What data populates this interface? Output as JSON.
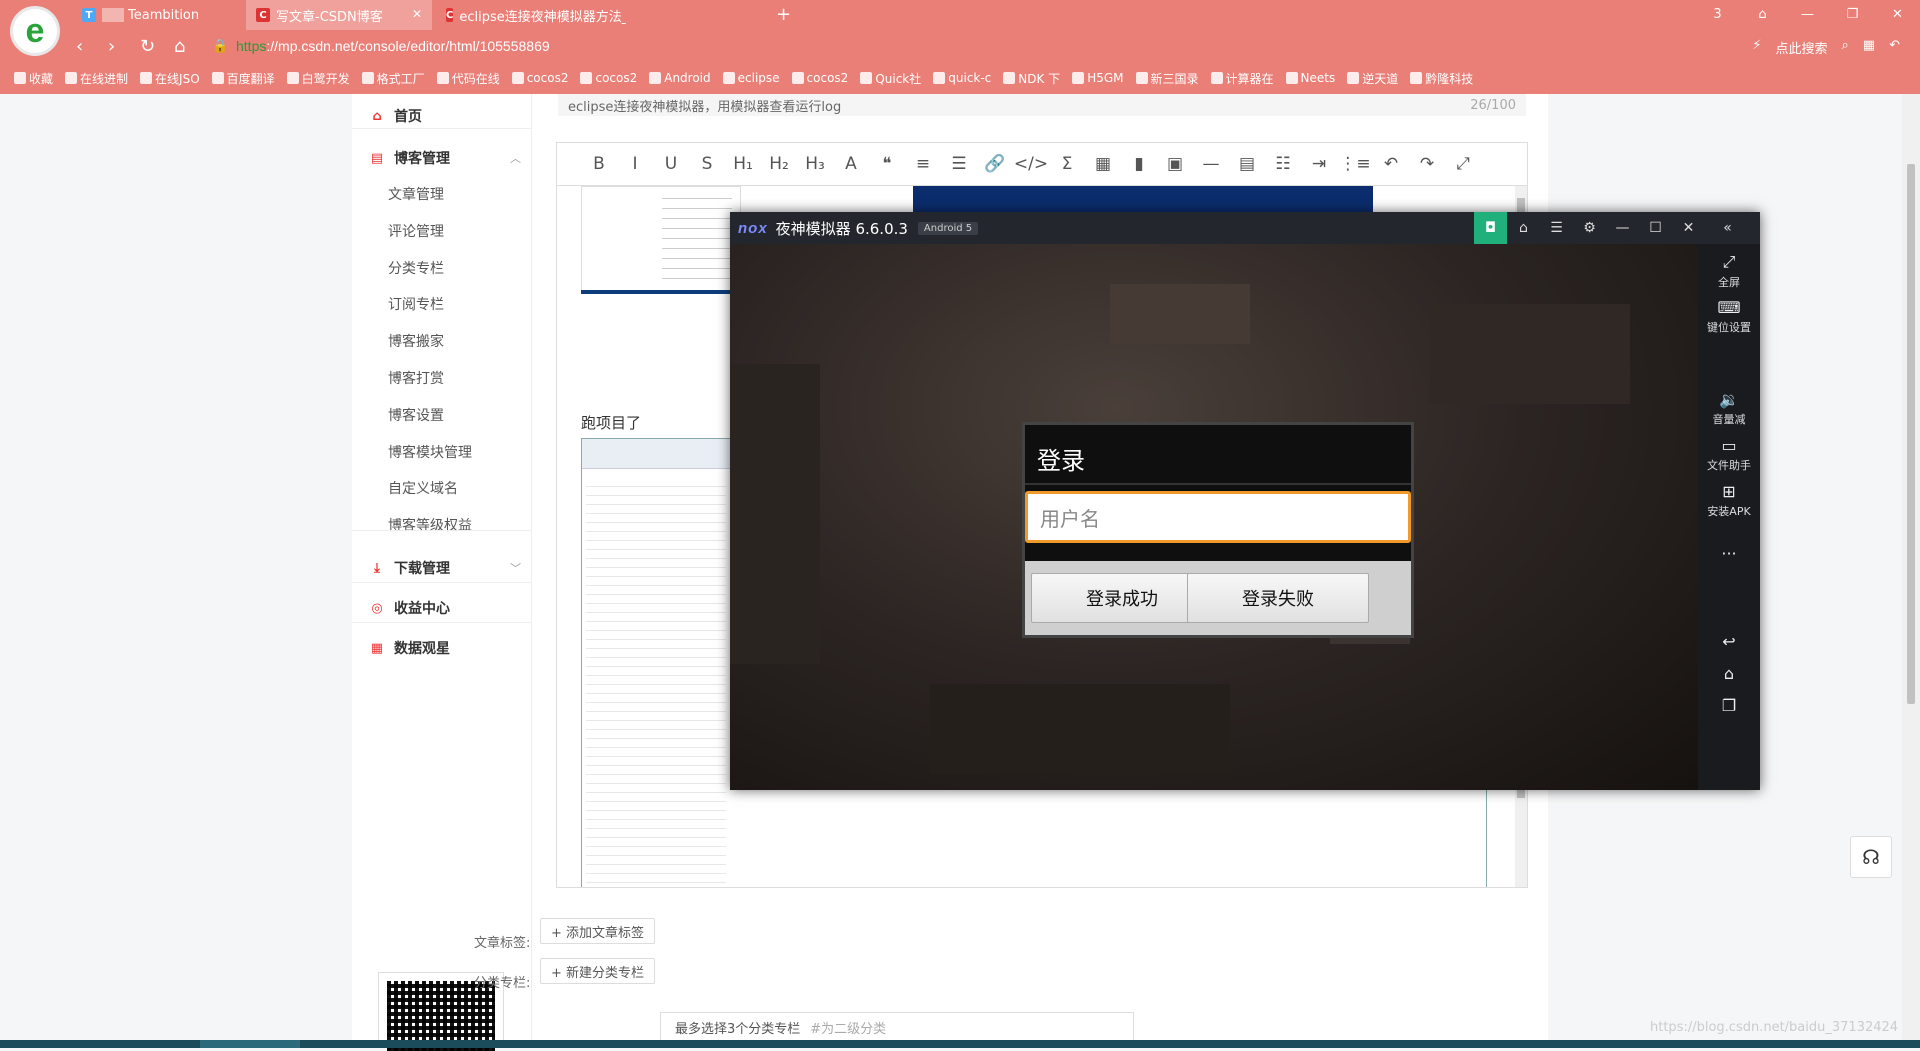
{
  "browser": {
    "tabs": [
      {
        "label": "Teambition",
        "favicon_color": "#4fa8f5",
        "favicon_text": "T"
      },
      {
        "label": "写文章-CSDN博客",
        "favicon_color": "#d33",
        "favicon_text": "C",
        "active": true
      },
      {
        "label": "eclipse连接夜神模拟器方法_开发",
        "favicon_color": "#d33",
        "favicon_text": "C"
      }
    ],
    "tab_count": "3",
    "url": "https://mp.csdn.net/console/editor/html/105558869",
    "url_scheme": "https",
    "url_rest": "://mp.csdn.net/console/editor/html/105558869",
    "search_label": "点此搜索",
    "bookmarks": [
      "收藏",
      "在线进制",
      "在线JSO",
      "百度翻译",
      "白鹭开发",
      "格式工厂",
      "代码在线",
      "cocos2",
      "cocos2",
      "Android",
      "eclipse",
      "cocos2",
      "Quick社",
      "quick-c",
      "NDK 下",
      "H5GM",
      "新三国录",
      "计算器在",
      "Neets",
      "逆天道",
      "黔隆科技"
    ]
  },
  "sidebar": {
    "home": "首页",
    "blog_manage": "博客管理",
    "blog_items": [
      "文章管理",
      "评论管理",
      "分类专栏",
      "订阅专栏",
      "博客搬家",
      "博客打赏",
      "博客设置",
      "博客模块管理",
      "自定义域名",
      "博客等级权益"
    ],
    "download_manage": "下载管理",
    "income_center": "收益中心",
    "data_view": "数据观星"
  },
  "editor": {
    "title_value": "eclipse连接夜神模拟器，用模拟器查看运行log",
    "title_count": "26/100",
    "toolbar": [
      "B",
      "I",
      "U",
      "S",
      "H₁",
      "H₂",
      "H₃",
      "A",
      "❝",
      "≡",
      "☰",
      "🔗",
      "</>",
      "Σ",
      "▦",
      "▮",
      "▣",
      "—",
      "▤",
      "☷",
      "⇥",
      "⋮≡",
      "↶",
      "↷",
      "⤢"
    ],
    "paragraph": "跑项目了"
  },
  "meta": {
    "tags_label": "文章标签:",
    "add_tag": "+ 添加文章标签",
    "category_label": "分类专栏:",
    "new_category": "+ 新建分类专栏",
    "category_hint": "最多选择3个分类专栏",
    "category_sub_hint": "#为二级分类"
  },
  "watermark": "https://blog.csdn.net/baidu_37132424",
  "nox": {
    "title": "夜神模拟器 6.6.0.3",
    "brand": "nox",
    "android_badge": "Android 5",
    "side_tools": [
      {
        "icon": "fullscreen-icon",
        "label": "全屏"
      },
      {
        "icon": "keyboard-icon",
        "label": "键位设置"
      },
      {
        "icon": "volume-down-icon",
        "label": "音量减"
      },
      {
        "icon": "file-helper-icon",
        "label": "文件助手"
      },
      {
        "icon": "install-apk-icon",
        "label": "安装APK"
      }
    ],
    "dialog": {
      "title": "登录",
      "username_placeholder": "用户名",
      "success_label": "登录成功",
      "fail_label": "登录失败"
    }
  }
}
